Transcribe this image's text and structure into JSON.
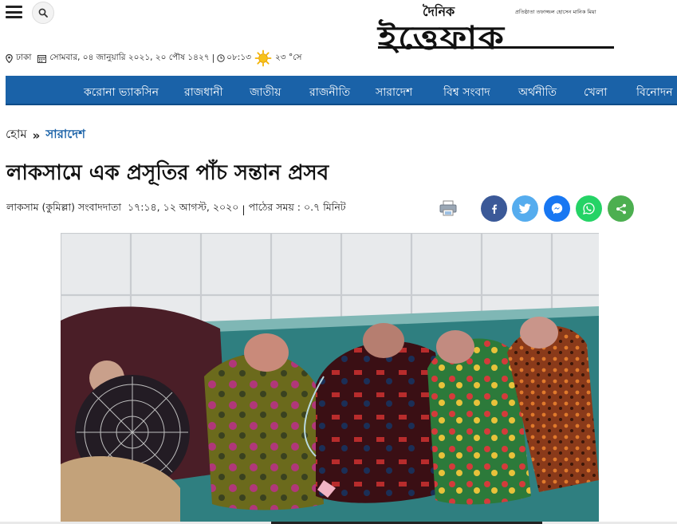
{
  "header": {
    "logo": {
      "small_text": "দৈনিক",
      "main_text": "ইত্তেফাক",
      "tagline": "প্রতিষ্ঠাতা তফাজ্জল হোসেন মানিক মিয়া"
    },
    "location": "ঢাকা",
    "date": "সোমবার, ০৪ জানুয়ারি ২০২১, ২০ পৌষ ১৪২৭",
    "time": "০৮:১৩",
    "temperature": "২৩ °সে"
  },
  "nav": {
    "items": [
      {
        "label": "করোনা ভ্যাকসিন"
      },
      {
        "label": "রাজধানী"
      },
      {
        "label": "জাতীয়"
      },
      {
        "label": "রাজনীতি"
      },
      {
        "label": "সারাদেশ"
      },
      {
        "label": "বিশ্ব সংবাদ"
      },
      {
        "label": "অর্থনীতি"
      },
      {
        "label": "খেলা"
      },
      {
        "label": "বিনোদন"
      }
    ]
  },
  "breadcrumb": {
    "home": "হোম",
    "separator": "»",
    "section": "সারাদেশ"
  },
  "article": {
    "title": "লাকসামে এক প্রসূতির পাঁচ সন্তান প্রসব",
    "reporter": "লাকসাম (কুমিল্লা) সংবাদদাতা",
    "published": "১৭:১৪, ১২ আগস্ট, ২০২০",
    "reading_time_label": "পাঠের সময় :",
    "reading_time_value": "০.৭ মিনিট"
  },
  "share": {
    "facebook_color": "#3b5998",
    "twitter_color": "#55acee",
    "messenger_color": "#1877f2",
    "whatsapp_color": "#25d366",
    "sharethis_color": "#4caf50"
  },
  "colors": {
    "nav_bg": "#1a62a8",
    "breadcrumb_section": "#1a62a8"
  }
}
